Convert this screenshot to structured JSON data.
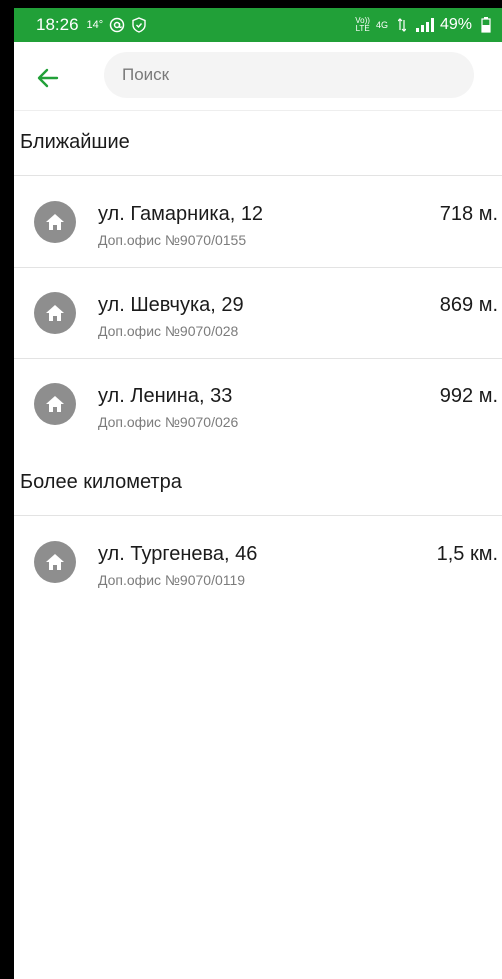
{
  "status_bar": {
    "time": "18:26",
    "temperature": "14°",
    "battery": "49%",
    "network": "4G",
    "volte": "Vo))",
    "lte": "LTE"
  },
  "search": {
    "placeholder": "Поиск",
    "value": ""
  },
  "sections": [
    {
      "title": "Ближайшие",
      "items": [
        {
          "address": "ул. Гамарника, 12",
          "office": "Доп.офис №9070/0155",
          "distance": "718 м."
        },
        {
          "address": "ул. Шевчука, 29",
          "office": "Доп.офис №9070/028",
          "distance": "869 м."
        },
        {
          "address": "ул. Ленина, 33",
          "office": "Доп.офис №9070/026",
          "distance": "992 м."
        }
      ]
    },
    {
      "title": "Более километра",
      "items": [
        {
          "address": "ул. Тургенева, 46",
          "office": "Доп.офис №9070/0119",
          "distance": "1,5 км."
        }
      ]
    }
  ],
  "colors": {
    "brand_green": "#21a038",
    "icon_gray": "#8e8e8e"
  },
  "icons": {
    "back": "arrow-left-icon",
    "branch": "home-icon"
  }
}
